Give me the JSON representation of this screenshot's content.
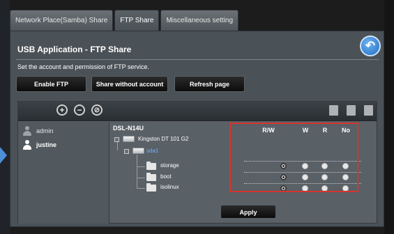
{
  "tabs": [
    {
      "label": "Network Place(Samba) Share"
    },
    {
      "label": "FTP Share"
    },
    {
      "label": "Miscellaneous setting"
    }
  ],
  "page": {
    "title": "USB Application - FTP Share",
    "description": "Set the account and permission of FTP service."
  },
  "buttons": {
    "enable_ftp": "Enable FTP",
    "share_without_account": "Share without account",
    "refresh_page": "Refresh page",
    "apply": "Apply"
  },
  "toolbar": {
    "add_icon": "plus-circle-icon",
    "remove_icon": "minus-circle-icon",
    "edit_icon": "pencil-circle-icon",
    "right_icons": [
      "add-folder-icon",
      "delete-folder-icon",
      "edit-folder-icon"
    ]
  },
  "users": [
    {
      "name": "admin",
      "selected": false
    },
    {
      "name": "justine",
      "selected": true
    }
  ],
  "tree": {
    "device": "DSL-N14U",
    "drive": "Kingston DT 101 G2",
    "partition": "sda1",
    "folders": [
      {
        "name": "storage",
        "permission": "R/W"
      },
      {
        "name": "boot",
        "permission": "R/W"
      },
      {
        "name": "isolinux",
        "permission": "R/W"
      }
    ]
  },
  "permission_headers": [
    "R/W",
    "W",
    "R",
    "No"
  ],
  "colors": {
    "panel": "#4b5257",
    "highlight_box": "#d8342c",
    "partition_link": "#6cb3ff",
    "back_button": "#1f6ec2"
  }
}
